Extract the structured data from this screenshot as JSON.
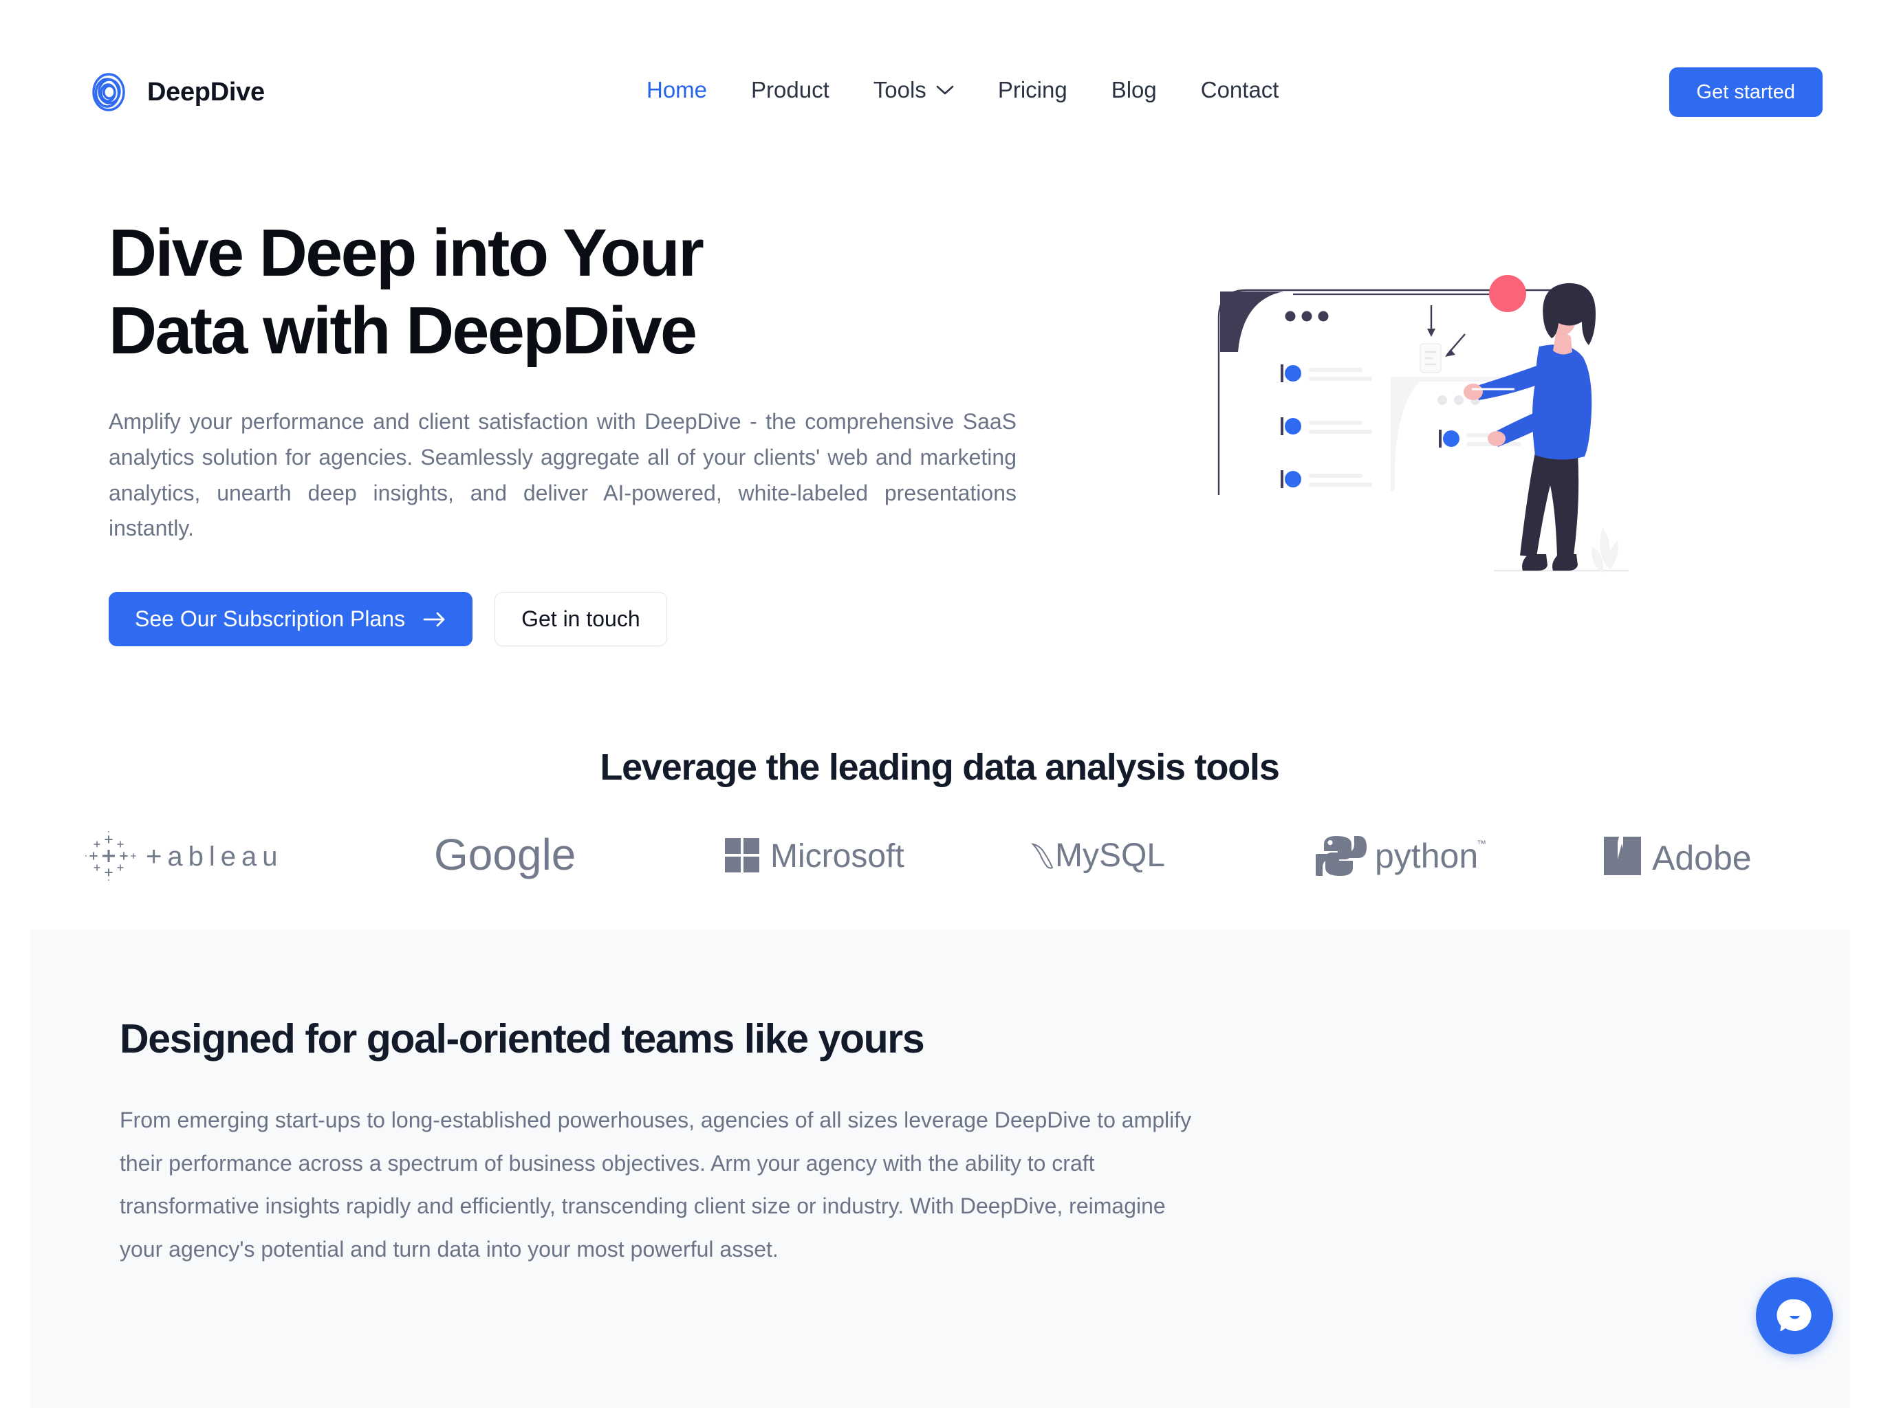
{
  "brand": {
    "name": "DeepDive",
    "logo_icon": "spiral-logo-icon",
    "accent": "#2f6bf0"
  },
  "nav": {
    "items": [
      {
        "label": "Home",
        "active": true
      },
      {
        "label": "Product",
        "active": false
      },
      {
        "label": "Tools",
        "active": false,
        "icon": "chevron-down-icon"
      },
      {
        "label": "Pricing",
        "active": false
      },
      {
        "label": "Blog",
        "active": false
      },
      {
        "label": "Contact",
        "active": false
      }
    ],
    "cta_label": "Get started"
  },
  "hero": {
    "title_line1": "Dive Deep into Your",
    "title_line2": "Data with DeepDive",
    "subtitle": "Amplify your performance and client satisfaction with DeepDive - the comprehensive SaaS analytics solution for agencies. Seamlessly aggregate all of your clients' web and marketing analytics, unearth deep insights, and deliver AI-powered, white-labeled presentations instantly.",
    "primary_button": "See Our Subscription Plans",
    "primary_button_icon": "arrow-right-icon",
    "secondary_button": "Get in touch",
    "illustration": "woman-with-dashboard-illustration"
  },
  "tools": {
    "heading": "Leverage the leading data analysis tools",
    "logos": [
      {
        "name": "Tableau",
        "icon": "tableau-logo-icon"
      },
      {
        "name": "Google",
        "icon": "google-logo-icon"
      },
      {
        "name": "Microsoft",
        "icon": "microsoft-logo-icon"
      },
      {
        "name": "MySQL",
        "icon": "mysql-logo-icon"
      },
      {
        "name": "python",
        "icon": "python-logo-icon"
      },
      {
        "name": "Adobe",
        "icon": "adobe-logo-icon"
      }
    ]
  },
  "designed_section": {
    "title": "Designed for goal-oriented teams like yours",
    "body": "From emerging start-ups to long-established powerhouses, agencies of all sizes leverage DeepDive to amplify their performance across a spectrum of business objectives. Arm your agency with the ability to craft transformative insights rapidly and efficiently, transcending client size or industry. With DeepDive, reimagine your agency's potential and turn data into your most powerful asset."
  },
  "chat": {
    "icon": "chat-bubble-icon",
    "color": "#2f6bf0"
  },
  "colors": {
    "accent_blue": "#2f6bf0",
    "nav_active": "#2563eb",
    "heading_dark": "#131a2a",
    "body_gray": "#6b7487",
    "logo_gray": "#6b7385",
    "section_bg": "#f8f9fb",
    "illustration_pink": "#fa6378",
    "illustration_navy": "#3f3d56"
  }
}
